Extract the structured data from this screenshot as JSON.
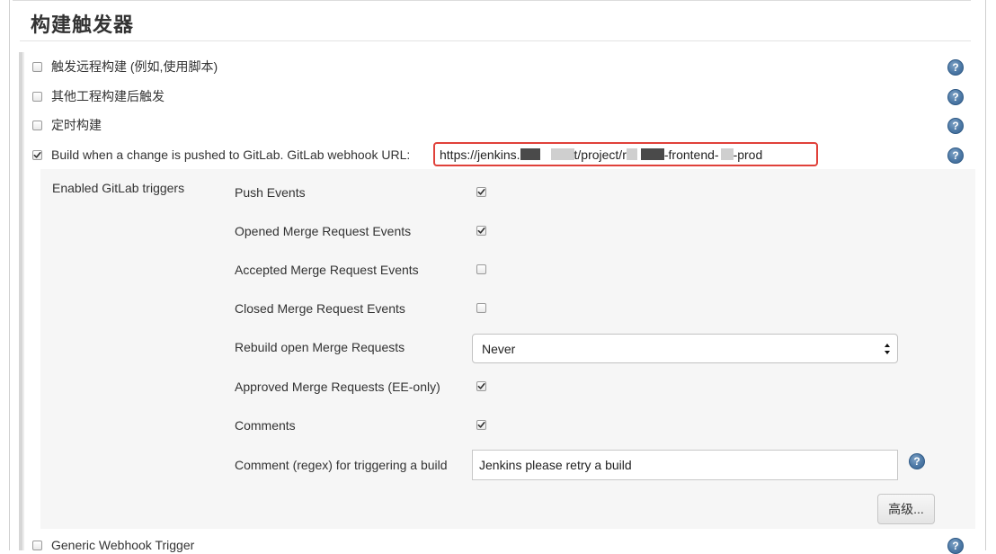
{
  "section": {
    "title": "构建触发器"
  },
  "triggers": [
    {
      "label": "触发远程构建 (例如,使用脚本)",
      "checked": false
    },
    {
      "label": "其他工程构建后触发",
      "checked": false
    },
    {
      "label": "定时构建",
      "checked": false
    },
    {
      "label": "Build when a change is pushed to GitLab. GitLab webhook URL:",
      "checked": true
    },
    {
      "label": "Generic Webhook Trigger",
      "checked": false
    }
  ],
  "webhook_url": {
    "part1": "https://jenkins.",
    "part2": "t/project/r",
    "part3": "-frontend-",
    "part4": "-prod"
  },
  "gitlab": {
    "section_label": "Enabled GitLab triggers",
    "options": [
      {
        "label": "Push Events",
        "checked": true
      },
      {
        "label": "Opened Merge Request Events",
        "checked": true
      },
      {
        "label": "Accepted Merge Request Events",
        "checked": false
      },
      {
        "label": "Closed Merge Request Events",
        "checked": false
      },
      {
        "label": "Rebuild open Merge Requests",
        "value": "Never"
      },
      {
        "label": "Approved Merge Requests (EE-only)",
        "checked": true
      },
      {
        "label": "Comments",
        "checked": true
      },
      {
        "label": "Comment (regex) for triggering a build",
        "value": "Jenkins please retry a build"
      }
    ],
    "advanced_button": "高级..."
  },
  "help_icon": {
    "glyph": "?",
    "color": "#4d79a6"
  },
  "colors": {
    "highlight_border": "#e0413a",
    "panel_bg": "#f6f6f6"
  }
}
